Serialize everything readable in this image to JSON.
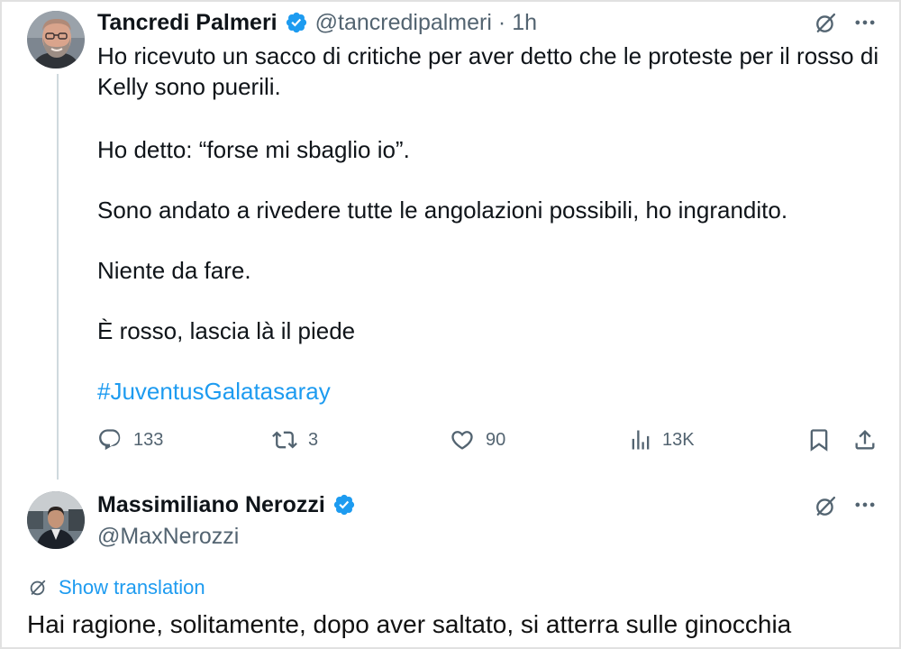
{
  "colors": {
    "text": "#0f1419",
    "secondary": "#536471",
    "accent": "#1d9bf0",
    "thread_line": "#cfd9de",
    "background": "#ffffff"
  },
  "icons": {
    "verified": "verified-badge-icon",
    "grok": "grok-icon",
    "more": "more-icon",
    "reply": "reply-icon",
    "repost": "repost-icon",
    "like": "heart-icon",
    "views": "views-icon",
    "bookmark": "bookmark-icon",
    "share": "share-icon",
    "translate": "translate-icon"
  },
  "tweet": {
    "author": {
      "name": "Tancredi Palmeri",
      "handle": "@tancredipalmeri",
      "separator": "·",
      "time": "1h",
      "verified": true
    },
    "paragraphs": [
      [
        "Ho ricevuto un sacco di critiche per aver detto che le proteste per il rosso di",
        "Kelly sono puerili."
      ],
      [
        "Ho detto: “forse mi sbaglio io”."
      ],
      [
        "Sono andato a rivedere tutte le angolazioni possibili, ho ingrandito."
      ],
      [
        "Niente da fare."
      ],
      [
        "È rosso, lascia là il piede"
      ]
    ],
    "hashtag": "#JuventusGalatasaray",
    "stats": {
      "replies": "133",
      "reposts": "3",
      "likes": "90",
      "views": "13K"
    }
  },
  "reply": {
    "author": {
      "name": "Massimiliano Nerozzi",
      "handle": "@MaxNerozzi",
      "verified": true
    },
    "show_translation": "Show translation",
    "text": "Hai ragione, solitamente, dopo aver saltato, si atterra sulle ginocchia"
  }
}
